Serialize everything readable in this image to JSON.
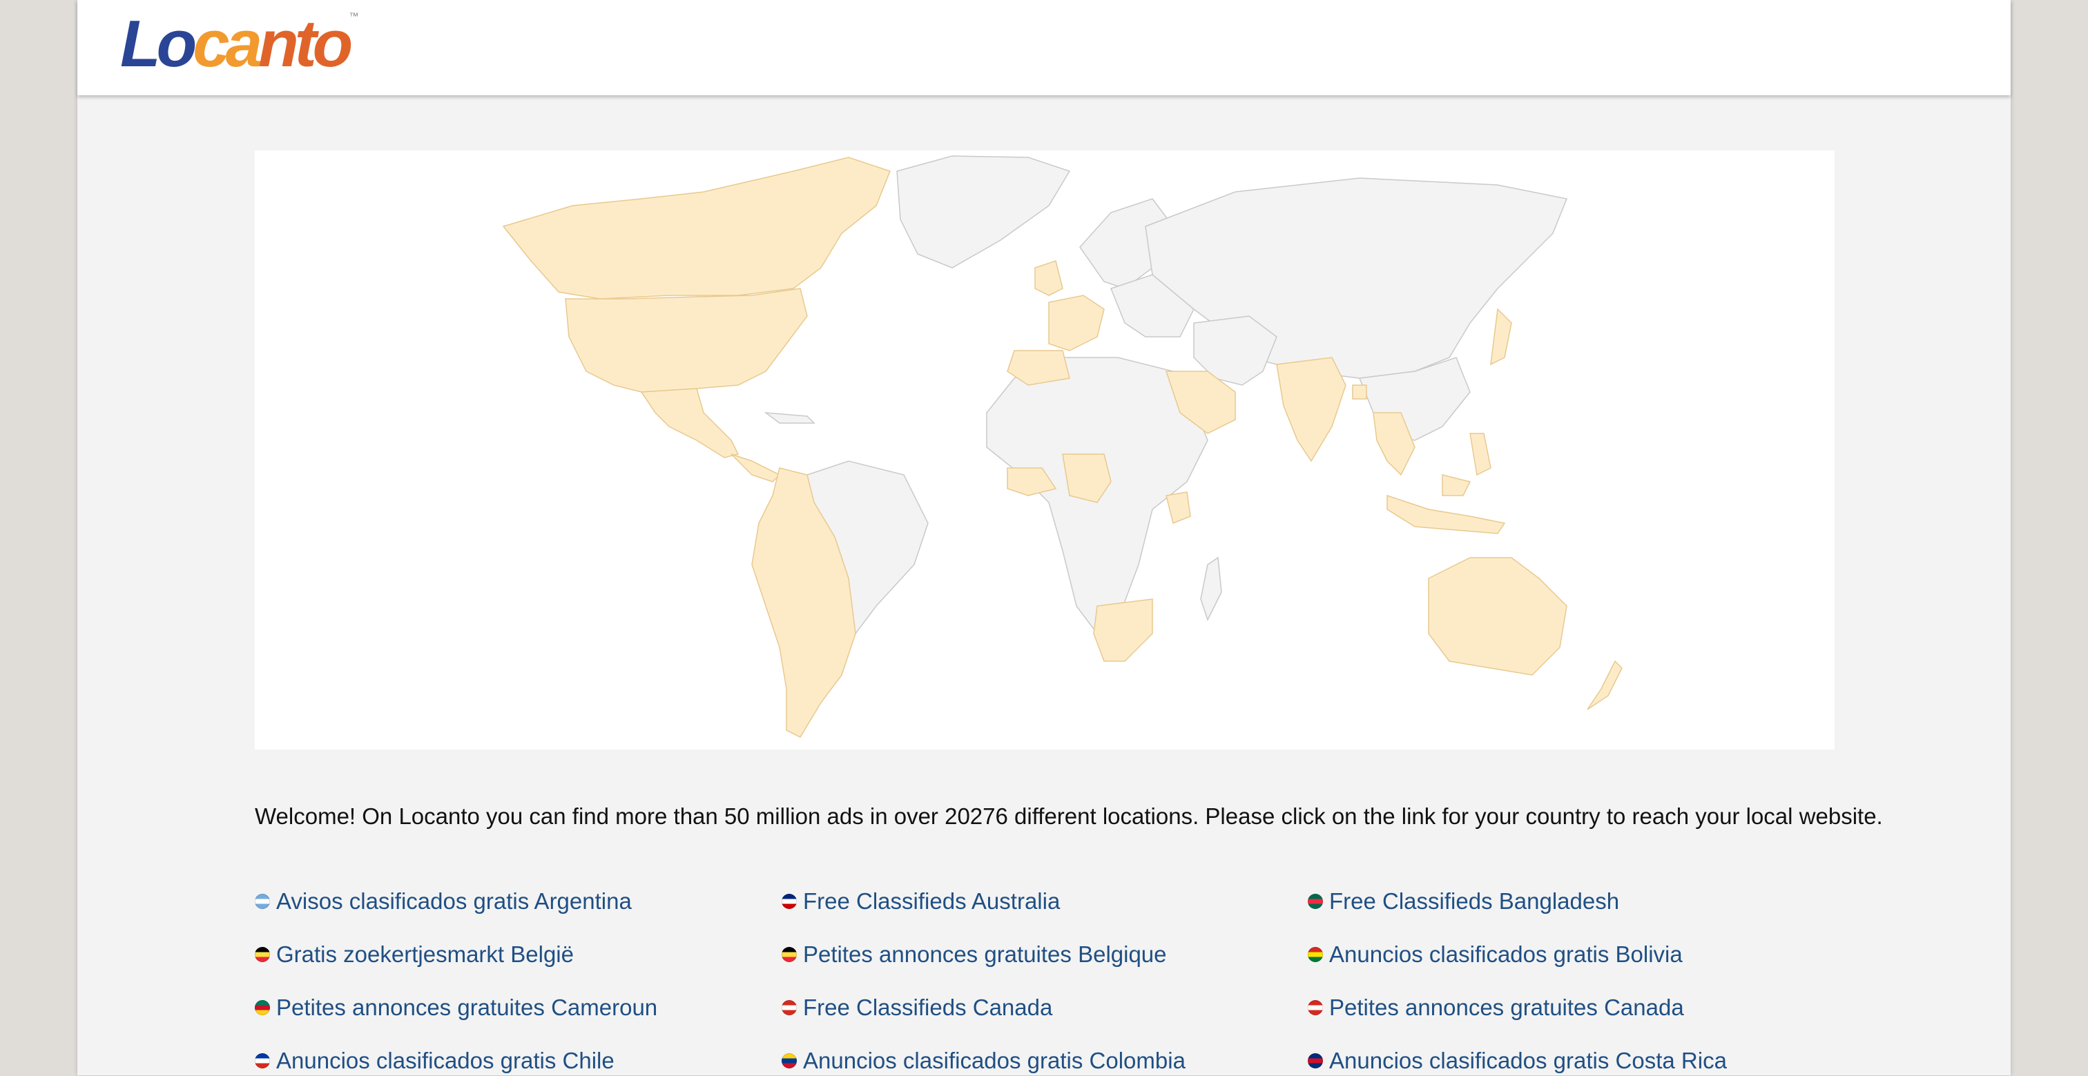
{
  "header": {
    "logo_text": "Locanto",
    "logo_parts": [
      "Lo",
      "ca",
      "nto"
    ],
    "trademark": "™"
  },
  "map": {
    "land_color": "#f3f3f3",
    "highlight_color": "#fdebc8",
    "border_color": "#c9c9c9"
  },
  "welcome_text": "Welcome! On Locanto you can find more than 50 million ads in over 20276 different locations. Please click on the link for your country to reach your local website.",
  "country_links": [
    {
      "label": "Avisos clasificados gratis Argentina",
      "flag": "argentina-flag-icon",
      "colors": [
        "#74acdf",
        "#ffffff",
        "#74acdf"
      ]
    },
    {
      "label": "Free Classifieds Australia",
      "flag": "australia-flag-icon",
      "colors": [
        "#00247d",
        "#ffffff",
        "#cc0000"
      ]
    },
    {
      "label": "Free Classifieds Bangladesh",
      "flag": "bangladesh-flag-icon",
      "colors": [
        "#006a4e",
        "#f42a41",
        "#006a4e"
      ]
    },
    {
      "label": "Gratis zoekertjesmarkt België",
      "flag": "belgium-flag-icon",
      "colors": [
        "#000000",
        "#fae042",
        "#ed2939"
      ]
    },
    {
      "label": "Petites annonces gratuites Belgique",
      "flag": "belgium-flag-icon",
      "colors": [
        "#000000",
        "#fae042",
        "#ed2939"
      ]
    },
    {
      "label": "Anuncios clasificados gratis Bolivia",
      "flag": "bolivia-flag-icon",
      "colors": [
        "#d52b1e",
        "#f9e300",
        "#007934"
      ]
    },
    {
      "label": "Petites annonces gratuites Cameroun",
      "flag": "cameroon-flag-icon",
      "colors": [
        "#007a5e",
        "#ce1126",
        "#fcd116"
      ]
    },
    {
      "label": "Free Classifieds Canada",
      "flag": "canada-flag-icon",
      "colors": [
        "#d52b1e",
        "#ffffff",
        "#d52b1e"
      ]
    },
    {
      "label": "Petites annonces gratuites Canada",
      "flag": "canada-flag-icon",
      "colors": [
        "#d52b1e",
        "#ffffff",
        "#d52b1e"
      ]
    },
    {
      "label": "Anuncios clasificados gratis Chile",
      "flag": "chile-flag-icon",
      "colors": [
        "#0039a6",
        "#ffffff",
        "#d52b1e"
      ]
    },
    {
      "label": "Anuncios clasificados gratis Colombia",
      "flag": "colombia-flag-icon",
      "colors": [
        "#fcd116",
        "#003893",
        "#ce1126"
      ]
    },
    {
      "label": "Anuncios clasificados gratis Costa Rica",
      "flag": "costa-rica-flag-icon",
      "colors": [
        "#002b7f",
        "#ce1126",
        "#002b7f"
      ]
    }
  ]
}
